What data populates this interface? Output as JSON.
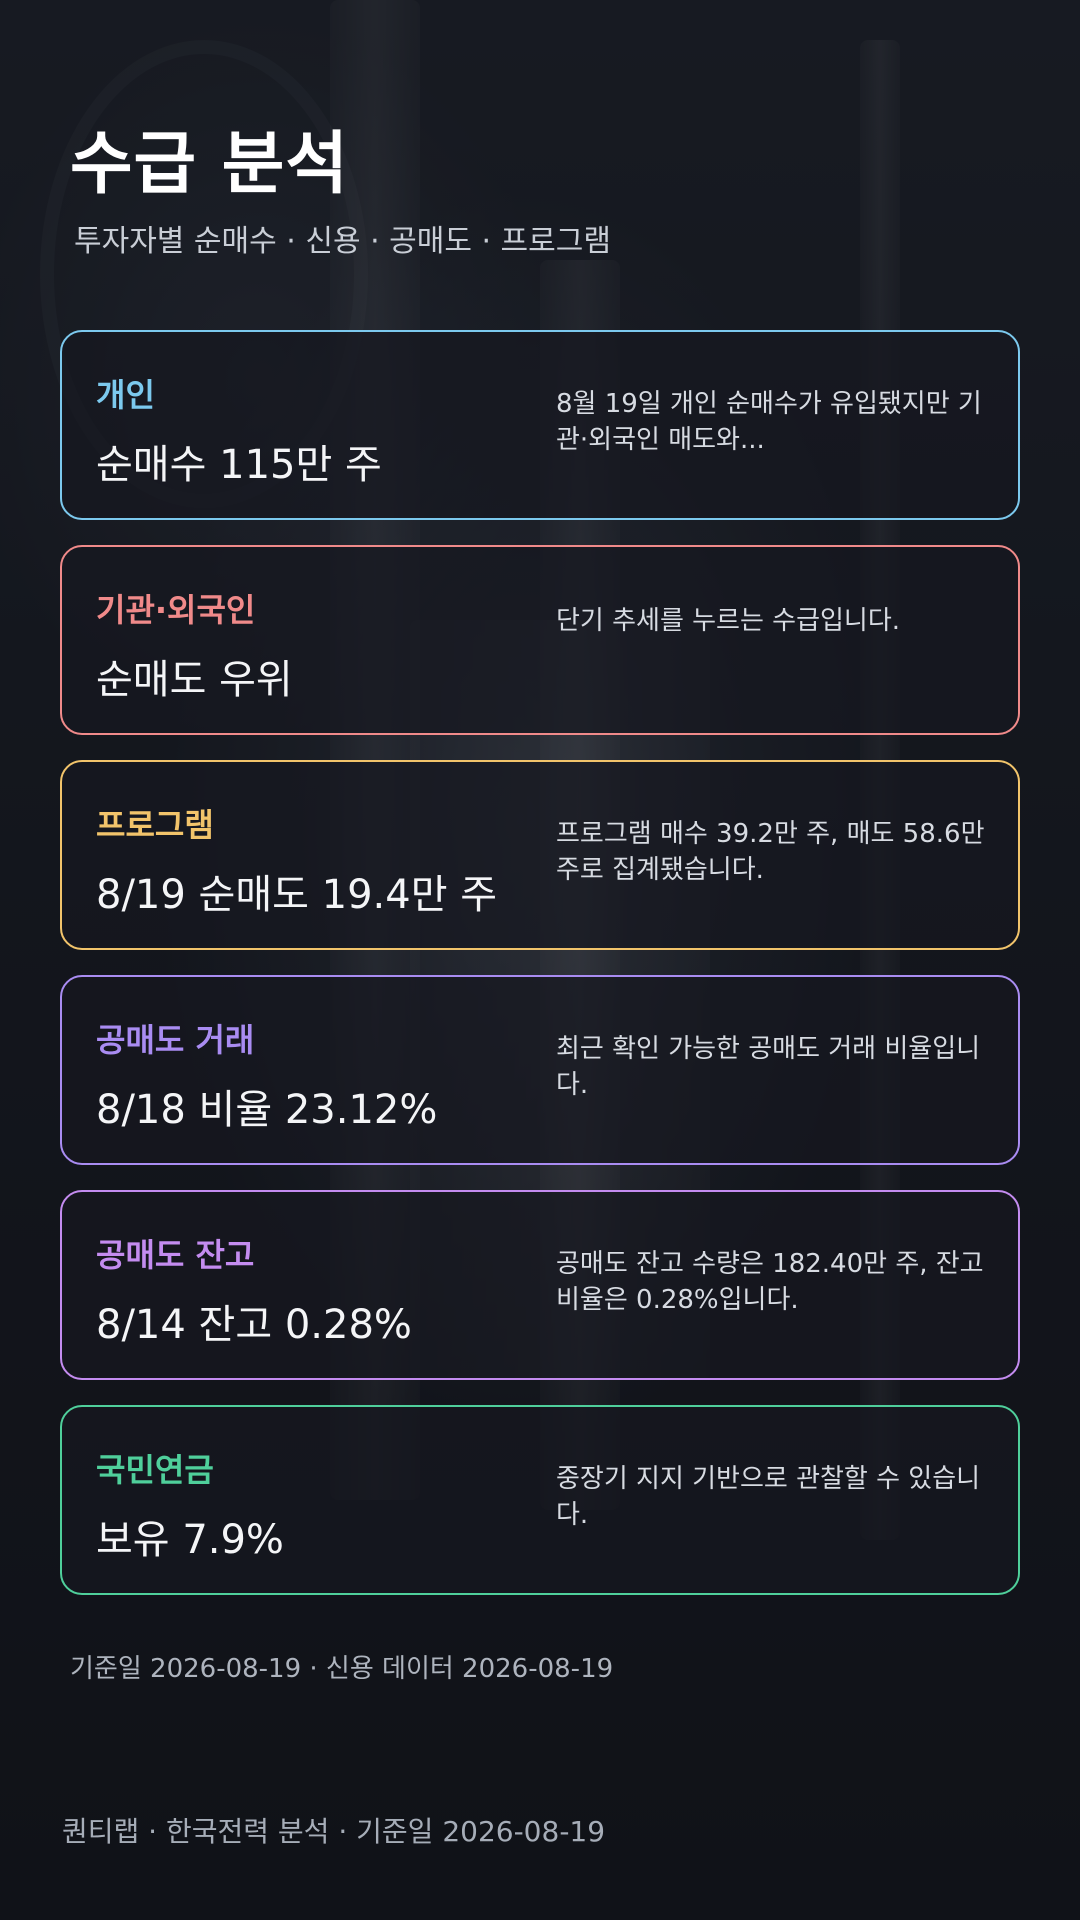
{
  "header": {
    "title": "수급 분석",
    "subtitle": "투자자별 순매수 · 신용 · 공매도 · 프로그램"
  },
  "cards": [
    {
      "label": "개인",
      "value": "순매수 115만 주",
      "description": "8월 19일 개인 순매수가 유입됐지만 기관·외국인 매도와...",
      "color": "#7cc9ee"
    },
    {
      "label": "기관·외국인",
      "value": "순매도 우위",
      "description": "단기 추세를 누르는 수급입니다.",
      "color": "#f08a8a"
    },
    {
      "label": "프로그램",
      "value": "8/19 순매도 19.4만 주",
      "description": "프로그램 매수 39.2만 주, 매도 58.6만 주로 집계됐습니다.",
      "color": "#f2c46b"
    },
    {
      "label": "공매도 거래",
      "value": "8/18 비율 23.12%",
      "description": "최근 확인 가능한 공매도 거래 비율입니다.",
      "color": "#a98cf2"
    },
    {
      "label": "공매도 잔고",
      "value": "8/14 잔고 0.28%",
      "description": "공매도 잔고 수량은 182.40만 주, 잔고 비율은 0.28%입니다.",
      "color": "#c48cf0"
    },
    {
      "label": "국민연금",
      "value": "보유 7.9%",
      "description": "중장기 지지 기반으로 관찰할 수 있습니다.",
      "color": "#4fcf9b"
    }
  ],
  "meta": "기준일 2026-08-19 · 신용 데이터 2026-08-19",
  "footer": "퀀티랩 · 한국전력 분석 · 기준일 2026-08-19"
}
